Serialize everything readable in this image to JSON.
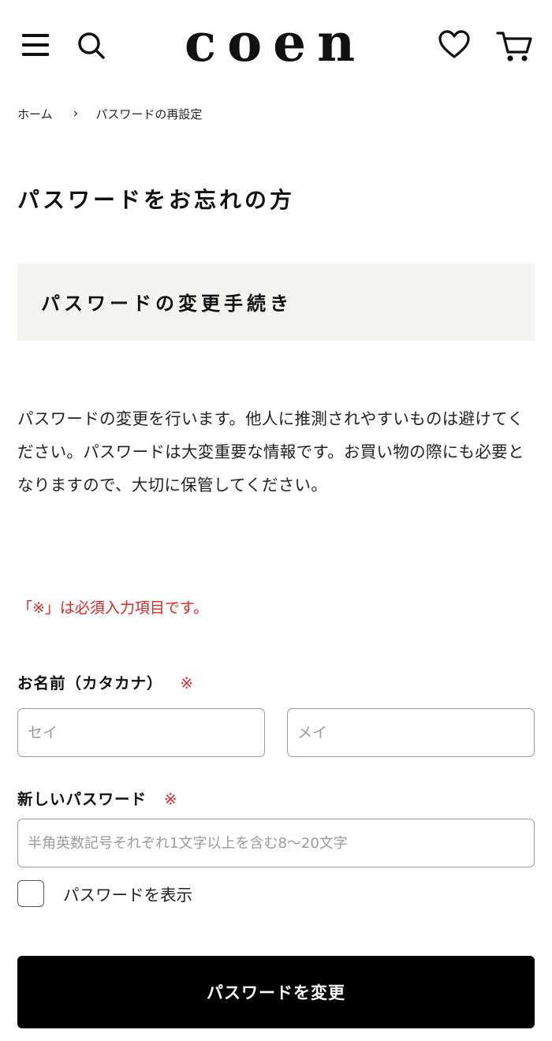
{
  "header": {
    "logo_text": "coen",
    "icons": [
      "menu-icon",
      "search-icon",
      "heart-icon",
      "cart-icon"
    ]
  },
  "breadcrumb": {
    "home": "ホーム",
    "separator": "›",
    "current": "パスワードの再設定"
  },
  "page_title": "パスワードをお忘れの方",
  "section": {
    "title": "パスワードの変更手続き"
  },
  "description": "パスワードの変更を行います。他人に推測されやすいものは避けてください。パスワードは大変重要な情報です。お買い物の際にも必要となりますので、大切に保管してください。",
  "required_note": "「※」は必須入力項目です。",
  "form": {
    "name_label": "お名前（カタカナ）",
    "required_mark": "※",
    "sei_placeholder": "セイ",
    "mei_placeholder": "メイ",
    "password_label": "新しいパスワード",
    "password_placeholder": "半角英数記号それぞれ1文字以上を含む8～20文字",
    "show_password_label": "パスワードを表示",
    "submit_label": "パスワードを変更"
  },
  "colors": {
    "accent_red": "#e02525",
    "button_bg": "#000000",
    "section_bg": "#f4f4f2"
  }
}
